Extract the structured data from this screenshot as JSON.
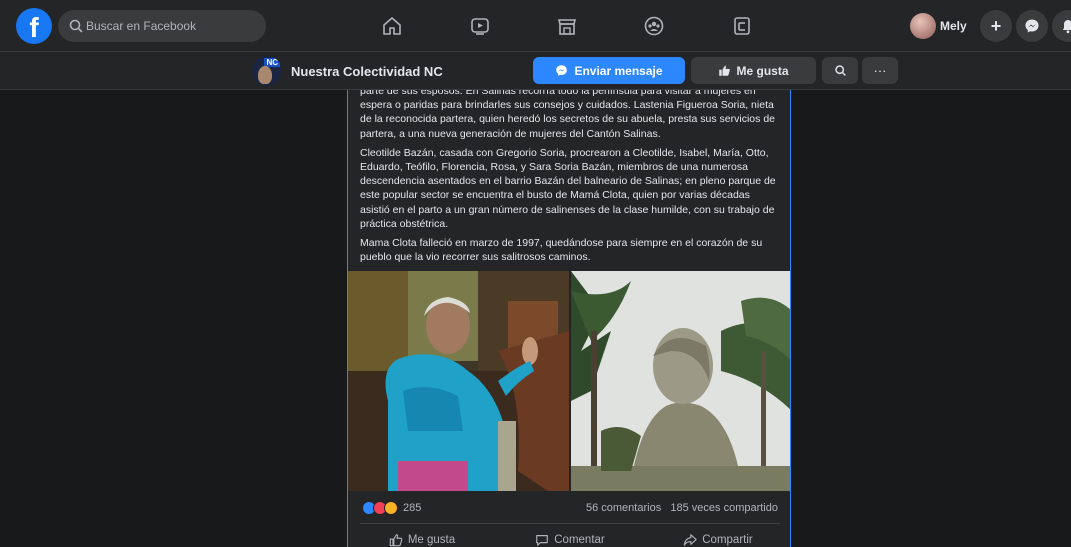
{
  "topbar": {
    "search_placeholder": "Buscar en Facebook",
    "profile_name": "Mely",
    "nav_icons": [
      "home-icon",
      "watch-icon",
      "marketplace-icon",
      "groups-icon",
      "gaming-icon"
    ],
    "brand_color": "#1877f2"
  },
  "page_header": {
    "page_name": "Nuestra Colectividad NC",
    "avatar_badge": "NC",
    "message_button": "Enviar mensaje",
    "like_button": "Me gusta",
    "more_label": "···"
  },
  "post": {
    "paragraphs": [
      "parte de sus esposos. En Salinas recorría todo la península para visitar a mujeres en espera o paridas para brindarles sus consejos y cuidados. Lastenia Figueroa Soria, nieta de la reconocida partera, quien heredó los secretos de su abuela, presta sus servicios de partera, a una nueva generación de mujeres del Cantón Salinas.",
      "Cleotilde Bazán, casada con Gregorio Soria, procrearon a Cleotilde, Isabel, María, Otto, Eduardo, Teófilo, Florencia, Rosa, y Sara Soria Bazán, miembros de una numerosa descendencia asentados en el barrio Bazán del balneario de Salinas; en pleno parque de este popular sector se encuentra el busto de Mamá Clota, quien por varias décadas asistió en el parto a un gran número de salinenses de la clase humilde, con su trabajo de práctica obstétrica.",
      "Mama Clota falleció en marzo de 1997, quedándose para siempre en el corazón de su pueblo que la vio recorrer sus salitrosos caminos."
    ],
    "reaction_count": "285",
    "comments": "56 comentarios",
    "shares": "185 veces compartido",
    "actions": {
      "like": "Me gusta",
      "comment": "Comentar",
      "share": "Compartir"
    }
  }
}
